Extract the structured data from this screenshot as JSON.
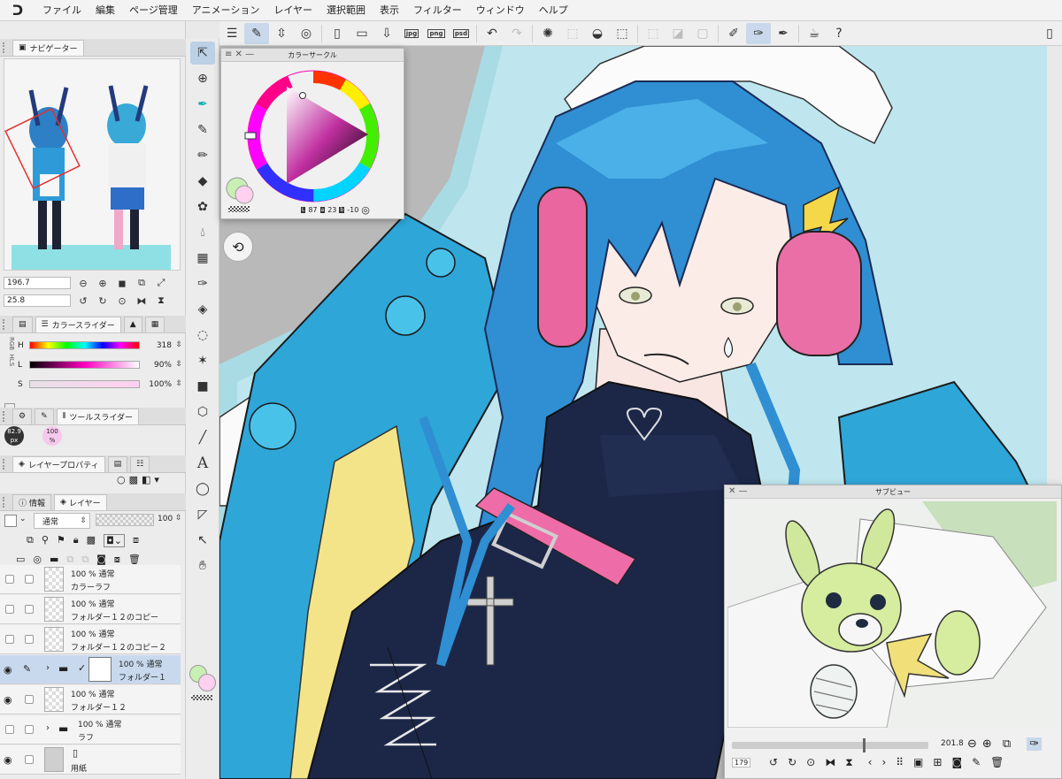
{
  "menu": {
    "logo": "ᑐ",
    "items": [
      "ファイル",
      "編集",
      "ページ管理",
      "アニメーション",
      "レイヤー",
      "選択範囲",
      "表示",
      "フィルター",
      "ウィンドウ",
      "ヘルプ"
    ]
  },
  "command_bar": {
    "icons": [
      "menu-icon",
      "cc-icon",
      "clip-icon",
      "new-file-icon",
      "open-folder-icon",
      "save-icon",
      "export-jpg-icon",
      "export-png-icon",
      "export-psd-icon",
      "undo-icon",
      "redo-icon",
      "loading-icon",
      "clear-icon",
      "fill-icon",
      "transform-icon",
      "deselect-icon",
      "invert-icon",
      "show-selection-icon",
      "pen-pressure-icon",
      "stabilize-icon",
      "brush-icon",
      "coloring-icon",
      "help-icon"
    ],
    "labels": {
      "jpg": "jpg",
      "png": "png",
      "psd": "psd"
    }
  },
  "navigator": {
    "tab_label": "ナビゲーター",
    "zoom": "196.7",
    "rotation": "25.8"
  },
  "color_slider": {
    "tab_label": "カラースライダー",
    "mode_rgb": "RGB",
    "mode_hls": "HLS",
    "rows": [
      {
        "label": "H",
        "value": "318"
      },
      {
        "label": "L",
        "value": "90%"
      },
      {
        "label": "S",
        "value": "100%"
      }
    ]
  },
  "tool_slider": {
    "tab_label": "ツールスライダー",
    "size": "82.9 px",
    "opacity": "100 %"
  },
  "layer_property": {
    "tab_label": "レイヤープロパティ"
  },
  "layer_panel": {
    "tab_info": "情報",
    "tab_layer": "レイヤー",
    "blend_mode": "通常",
    "opacity": "100",
    "layers": [
      {
        "line1": "100 % 通常",
        "line2": "カラーラフ",
        "visible": false,
        "selected": false
      },
      {
        "line1": "100 % 通常",
        "line2": "フォルダー１２のコピー",
        "visible": false,
        "selected": false
      },
      {
        "line1": "100 % 通常",
        "line2": "フォルダー１２のコピー２",
        "visible": false,
        "selected": false
      },
      {
        "line1": "100 % 通常",
        "line2": "フォルダー１",
        "visible": true,
        "selected": true
      },
      {
        "line1": "100 % 通常",
        "line2": "フォルダー１２",
        "visible": true,
        "selected": false
      },
      {
        "line1": "100 % 通常",
        "line2": "ラフ",
        "visible": false,
        "selected": false
      },
      {
        "line1": "",
        "line2": "用紙",
        "visible": true,
        "selected": false
      }
    ]
  },
  "color_circle": {
    "title": "カラーサークル",
    "h_label": "L",
    "h_value": "87",
    "s_label": "a",
    "s_value": "23",
    "v_label": "b",
    "v_value": "-10"
  },
  "sub_view": {
    "title": "サブビュー",
    "zoom": "201.8",
    "small_value": "179"
  },
  "colors": {
    "accent": "#bcd0e6",
    "main_color": "#c8f0b4",
    "sub_color": "#ffd0f0"
  }
}
